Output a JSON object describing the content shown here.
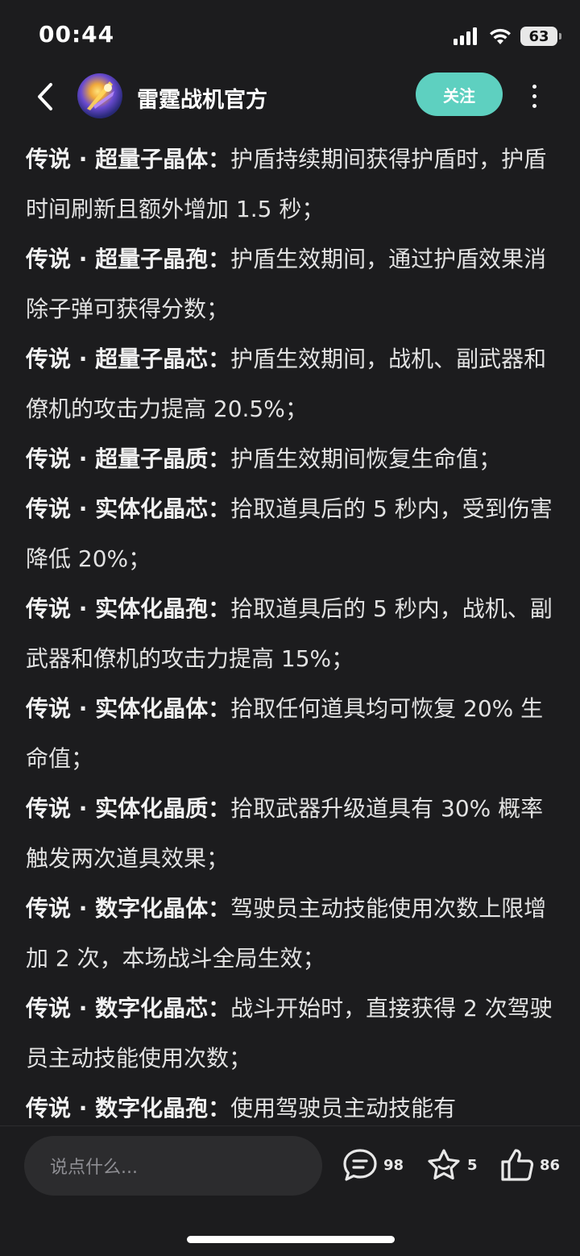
{
  "status_bar": {
    "time": "00:44",
    "battery": "63"
  },
  "header": {
    "channel_name": "雷霆战机官方",
    "follow_label": "关注"
  },
  "items": [
    {
      "title": "传说 · 超量子晶体：",
      "text": "护盾持续期间获得护盾时，护盾时间刷新且额外增加 1.5 秒；"
    },
    {
      "title": "传说 · 超量子晶孢：",
      "text": "护盾生效期间，通过护盾效果消除子弹可获得分数；"
    },
    {
      "title": "传说 · 超量子晶芯：",
      "text": "护盾生效期间，战机、副武器和僚机的攻击力提高 20.5%；"
    },
    {
      "title": "传说 · 超量子晶质：",
      "text": "护盾生效期间恢复生命值；"
    },
    {
      "title": "传说 · 实体化晶芯：",
      "text": "拾取道具后的 5 秒内，受到伤害降低 20%；"
    },
    {
      "title": "传说 · 实体化晶孢：",
      "text": "拾取道具后的 5 秒内，战机、副武器和僚机的攻击力提高 15%；"
    },
    {
      "title": "传说 · 实体化晶体：",
      "text": "拾取任何道具均可恢复 20% 生命值；"
    },
    {
      "title": "传说 · 实体化晶质：",
      "text": "拾取武器升级道具有 30% 概率触发两次道具效果；"
    },
    {
      "title": "传说 · 数字化晶体：",
      "text": "驾驶员主动技能使用次数上限增加 2 次，本场战斗全局生效；"
    },
    {
      "title": "传说 · 数字化晶芯：",
      "text": "战斗开始时，直接获得 2 次驾驶员主动技能使用次数；"
    },
    {
      "title": "传说 · 数字化晶孢：",
      "text": "使用驾驶员主动技能有"
    }
  ],
  "bottom_bar": {
    "comment_placeholder": "说点什么...",
    "comment_count": "98",
    "favorite_count": "5",
    "like_count": "86"
  },
  "colors": {
    "background": "#1c1c1e",
    "follow_button": "#5ed0c0",
    "input_bg": "#2c2c2e"
  }
}
